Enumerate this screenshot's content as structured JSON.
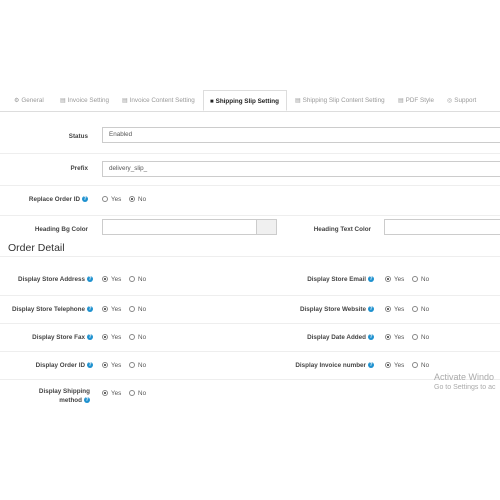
{
  "tabs": [
    {
      "label": "General",
      "icon": "gear-icon",
      "glyph": "⚙"
    },
    {
      "label": "Invoice Setting",
      "icon": "file-icon",
      "glyph": "▤"
    },
    {
      "label": "Invoice Content Setting",
      "icon": "file-text-icon",
      "glyph": "▤"
    },
    {
      "label": "Shipping Slip Setting",
      "icon": "truck-icon",
      "glyph": "■"
    },
    {
      "label": "Shipping Slip Content Setting",
      "icon": "file-text-icon",
      "glyph": "▤"
    },
    {
      "label": "PDF Style",
      "icon": "pdf-icon",
      "glyph": "▤"
    },
    {
      "label": "Support",
      "icon": "life-ring-icon",
      "glyph": "◎"
    }
  ],
  "active_tab": "Shipping Slip Setting",
  "form": {
    "status": {
      "label": "Status",
      "value": "Enabled"
    },
    "prefix": {
      "label": "Prefix",
      "value": "delivery_slip_"
    },
    "replace_order_id": {
      "label": "Replace Order ID",
      "selected": "No"
    },
    "heading_bg_color": {
      "label": "Heading Bg Color",
      "value": ""
    },
    "heading_text_color": {
      "label": "Heading Text Color",
      "value": ""
    }
  },
  "radio_options": {
    "yes": "Yes",
    "no": "No"
  },
  "section_title": "Order Detail",
  "order_detail": {
    "left": [
      {
        "label": "Display Store Address",
        "selected": "Yes"
      },
      {
        "label": "Display Store Telephone",
        "selected": "Yes"
      },
      {
        "label": "Display Store Fax",
        "selected": "Yes"
      },
      {
        "label": "Display Order ID",
        "selected": "Yes"
      },
      {
        "label_line1": "Display Shipping",
        "label_line2": "method",
        "selected": "Yes"
      }
    ],
    "right": [
      {
        "label": "Display Store Email",
        "selected": "Yes"
      },
      {
        "label": "Display Store Website",
        "selected": "Yes"
      },
      {
        "label": "Display Date Added",
        "selected": "Yes"
      },
      {
        "label": "Display Invoice number",
        "selected": "Yes"
      }
    ]
  },
  "watermark": {
    "line1": "Activate Windo",
    "line2": "Go to Settings to ac"
  }
}
